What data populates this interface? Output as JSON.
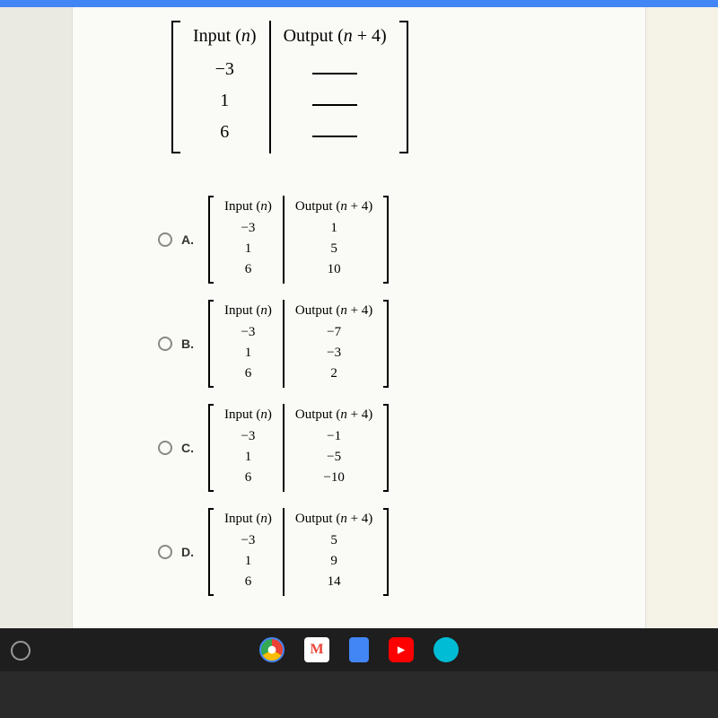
{
  "main_table": {
    "head_input": "Input (n)",
    "head_output": "Output (n + 4)",
    "inputs": [
      "−3",
      "1",
      "6"
    ],
    "outputs_blank": true
  },
  "options": [
    {
      "label": "A.",
      "head_input": "Input (n)",
      "head_output": "Output (n + 4)",
      "inputs": [
        "−3",
        "1",
        "6"
      ],
      "outputs": [
        "1",
        "5",
        "10"
      ]
    },
    {
      "label": "B.",
      "head_input": "Input (n)",
      "head_output": "Output (n + 4)",
      "inputs": [
        "−3",
        "1",
        "6"
      ],
      "outputs": [
        "−7",
        "−3",
        "2"
      ]
    },
    {
      "label": "C.",
      "head_input": "Input (n)",
      "head_output": "Output (n + 4)",
      "inputs": [
        "−3",
        "1",
        "6"
      ],
      "outputs": [
        "−1",
        "−5",
        "−10"
      ]
    },
    {
      "label": "D.",
      "head_input": "Input (n)",
      "head_output": "Output (n + 4)",
      "inputs": [
        "−3",
        "1",
        "6"
      ],
      "outputs": [
        "5",
        "9",
        "14"
      ]
    }
  ],
  "chart_data": {
    "type": "table",
    "question_table": {
      "columns": [
        "Input (n)",
        "Output (n + 4)"
      ],
      "rows": [
        [
          "-3",
          ""
        ],
        [
          "1",
          ""
        ],
        [
          "6",
          ""
        ]
      ]
    },
    "answer_choices": {
      "A": {
        "inputs": [
          -3,
          1,
          6
        ],
        "outputs": [
          1,
          5,
          10
        ]
      },
      "B": {
        "inputs": [
          -3,
          1,
          6
        ],
        "outputs": [
          -7,
          -3,
          2
        ]
      },
      "C": {
        "inputs": [
          -3,
          1,
          6
        ],
        "outputs": [
          -1,
          -5,
          -10
        ]
      },
      "D": {
        "inputs": [
          -3,
          1,
          6
        ],
        "outputs": [
          5,
          9,
          14
        ]
      }
    }
  },
  "collapse_glyph": "«"
}
